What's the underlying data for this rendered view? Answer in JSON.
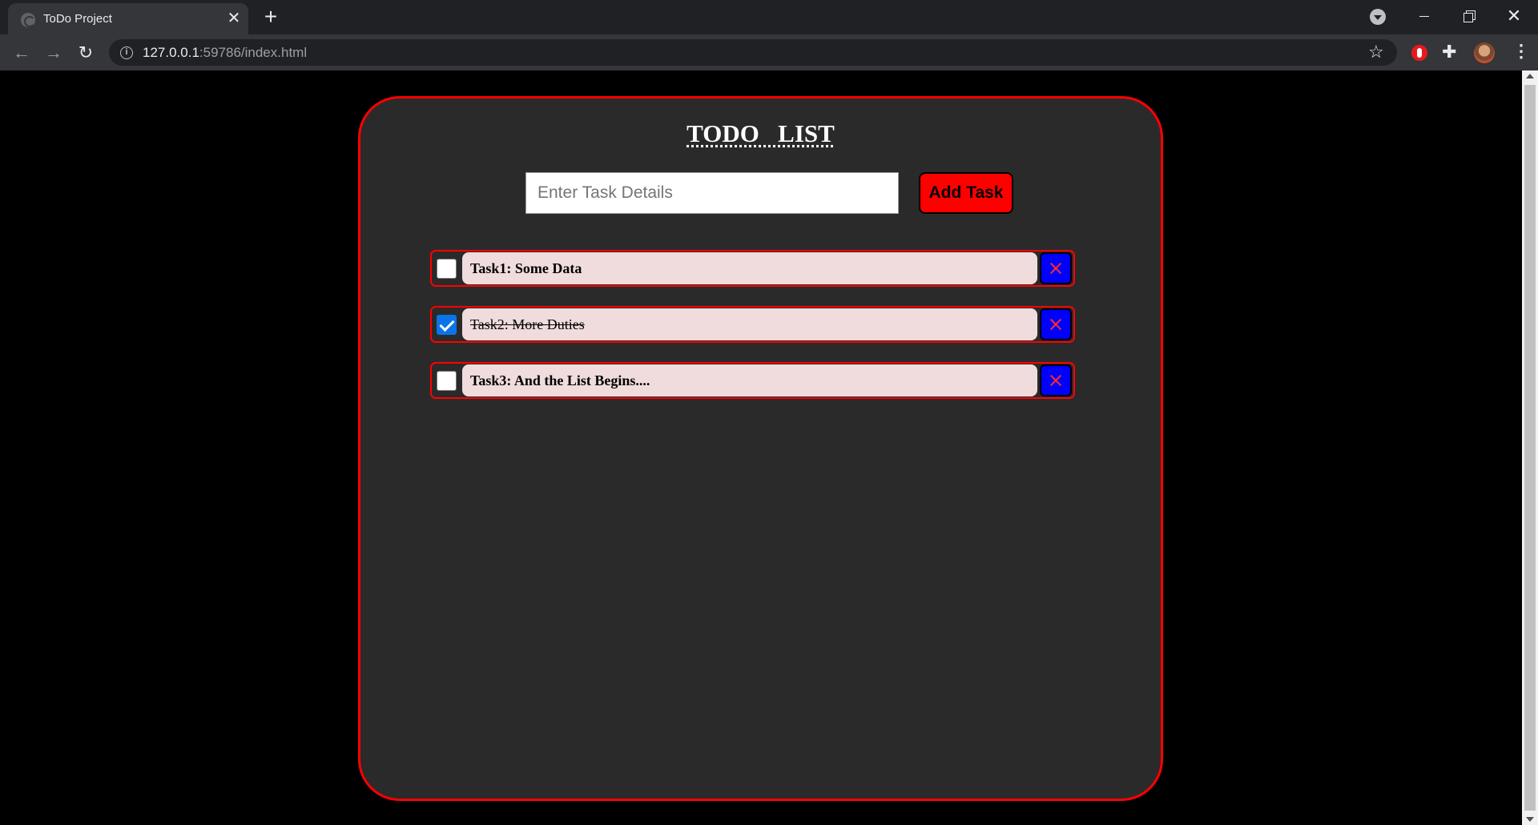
{
  "browser": {
    "tab_title": "ToDo Project",
    "tab_close": "✕",
    "new_tab": "+",
    "url_host": "127.0.0.1",
    "url_path": ":59786/index.html",
    "close_window": "✕"
  },
  "page": {
    "heading": "TODO   LIST",
    "input_placeholder": "Enter Task Details",
    "add_button": "Add Task",
    "tasks": [
      {
        "text": "Task1: Some Data",
        "done": false
      },
      {
        "text": "Task2: More Duties",
        "done": true
      },
      {
        "text": "Task3: And the List Begins....",
        "done": false
      }
    ]
  },
  "colors": {
    "card_border": "#ff0000",
    "card_bg": "#2a2a2a",
    "add_button_bg": "#ff0000",
    "delete_button_bg": "#0000ff",
    "task_bg": "#f0dcdc",
    "checkbox_checked": "#0a75e8"
  }
}
